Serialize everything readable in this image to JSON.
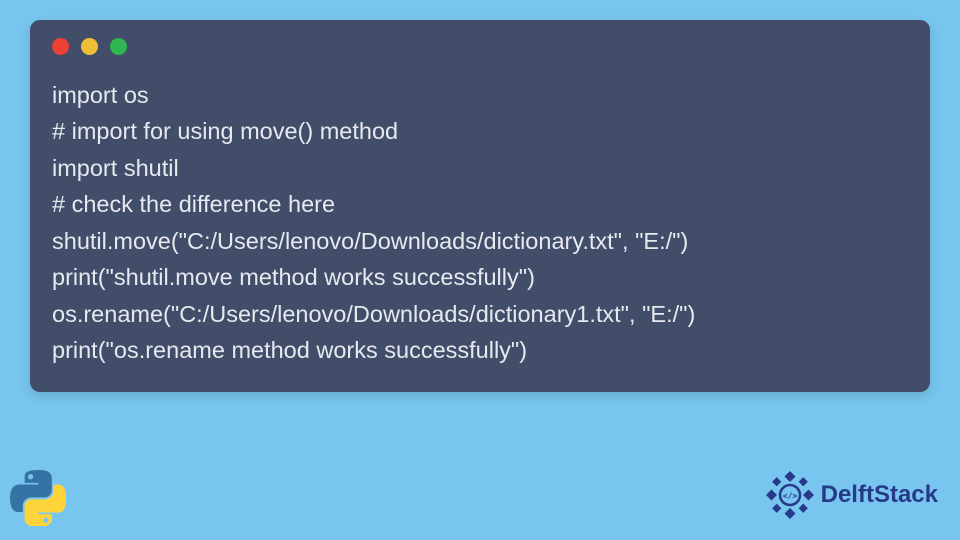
{
  "code": {
    "lines": [
      "import os",
      "# import for using move() method",
      "import shutil",
      "# check the difference here",
      "shutil.move(\"C:/Users/lenovo/Downloads/dictionary.txt\", \"E:/\")",
      "print(\"shutil.move method works successfully\")",
      "os.rename(\"C:/Users/lenovo/Downloads/dictionary1.txt\", \"E:/\")",
      "print(\"os.rename method works successfully\")"
    ]
  },
  "branding": {
    "name": "DelftStack"
  }
}
